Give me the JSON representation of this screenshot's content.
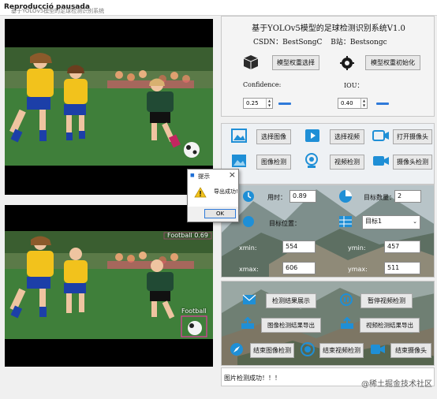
{
  "window": {
    "title": "Reproducció pausada",
    "overlay_text": "基于YOLOv5模型的足球检测识别系统"
  },
  "header": {
    "system_title": "基于YOLOv5模型的足球检测识别系统V1.0",
    "csdn": "CSDN：BestSongC",
    "bilibili": "B站：Bestsongc",
    "model_select": "模型权重选择",
    "model_init": "模型权重初始化",
    "confidence_label": "Confidence:",
    "iou_label": "IOU：",
    "confidence_value": "0.25",
    "iou_value": "0.40"
  },
  "media_buttons": {
    "select_image": "选择图像",
    "select_video": "选择视频",
    "open_camera": "打开摄像头",
    "image_detect": "图像检测",
    "video_detect": "视频检测",
    "camera_detect": "摄像头检测"
  },
  "result": {
    "time_label": "用时：",
    "time_value": "0.89",
    "target_count_label": "目标数量：",
    "target_count_value": "2",
    "target_pos_label": "目标位置：",
    "target_select": "目标1",
    "xmin_label": "xmin:",
    "xmin_value": "554",
    "ymin_label": "ymin:",
    "ymin_value": "457",
    "xmax_label": "xmax:",
    "xmax_value": "606",
    "ymax_label": "ymax:",
    "ymax_value": "511"
  },
  "actions": {
    "show_result": "检测结果展示",
    "pause_video": "暂停视频检测",
    "export_image": "图像检测结果导出",
    "export_video": "视频检测结果导出",
    "end_image": "结束图像检测",
    "end_video": "结束视频检测",
    "end_camera": "结束摄像头"
  },
  "status": {
    "message": "图片检测成功！！！"
  },
  "detections": {
    "label_1": "Football 0.69",
    "label_2": "Football"
  },
  "dialog": {
    "title": "提示",
    "message": "导出成功!",
    "ok": "OK"
  },
  "watermark": "@稀土掘金技术社区",
  "colors": {
    "accent": "#2f7ad9",
    "bbox": "#e63aa0"
  }
}
